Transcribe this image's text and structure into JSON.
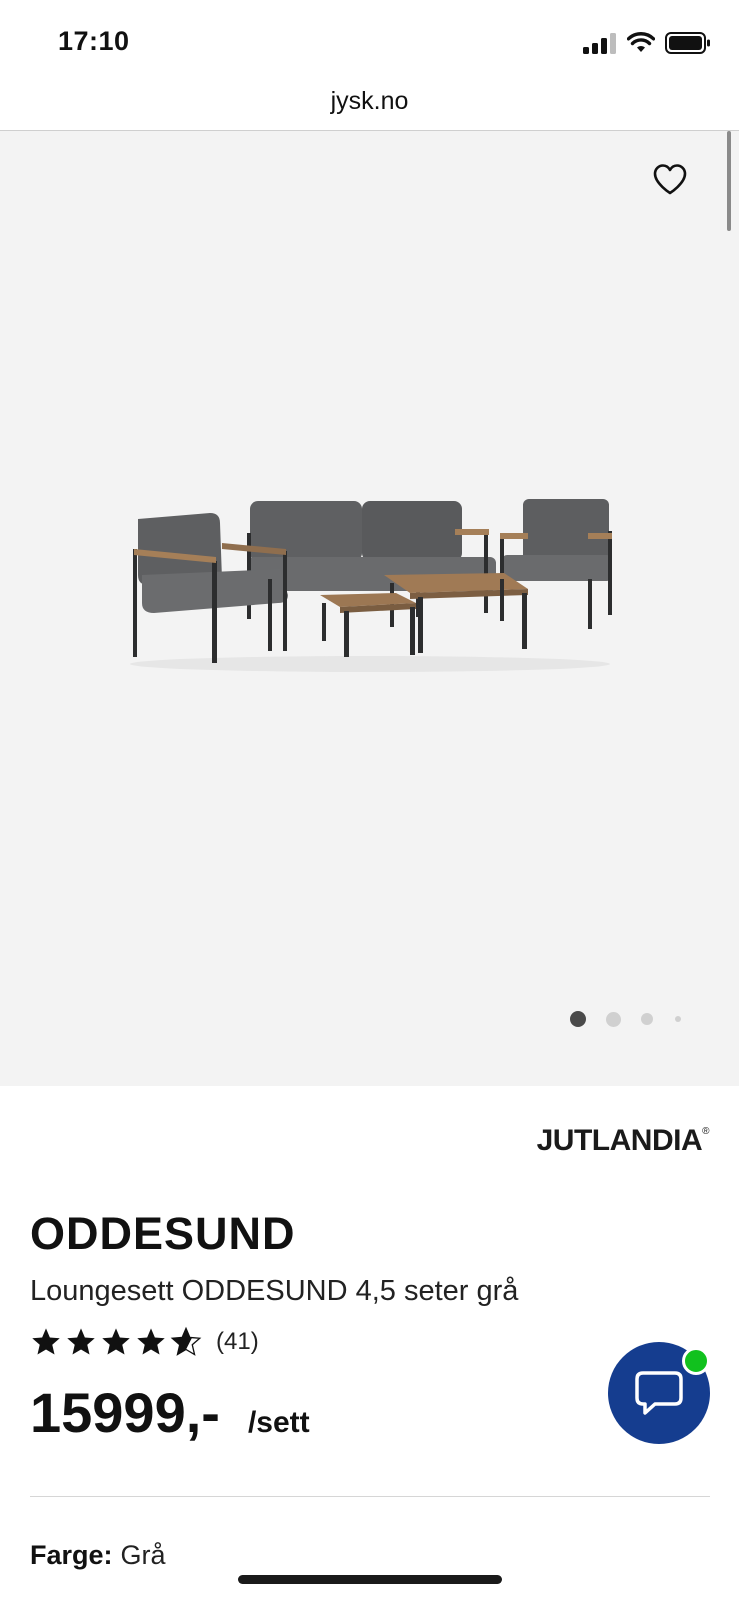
{
  "status": {
    "time": "17:10"
  },
  "address": {
    "url": "jysk.no"
  },
  "gallery": {
    "image_alt": "Loungesett ODDESUND",
    "slides": 4,
    "active_slide": 1
  },
  "product": {
    "brand": "JUTLANDIA",
    "brand_mark": "®",
    "name": "ODDESUND",
    "description": "Loungesett ODDESUND 4,5 seter grå",
    "rating": 4.5,
    "rating_max": 5,
    "review_count": "(41)",
    "price": "15999,-",
    "unit": "/sett",
    "color_label": "Farge:",
    "color_value": "Grå"
  },
  "chat": {
    "online": true
  },
  "colors": {
    "chat_bg": "#153d8f",
    "online_dot": "#11c11e",
    "gallery_bg": "#f3f3f3"
  },
  "icons": {
    "wishlist": "heart-outline-icon",
    "chat": "speech-bubble-icon",
    "signal": "cellular-signal-icon",
    "wifi": "wifi-icon",
    "battery": "battery-icon"
  }
}
